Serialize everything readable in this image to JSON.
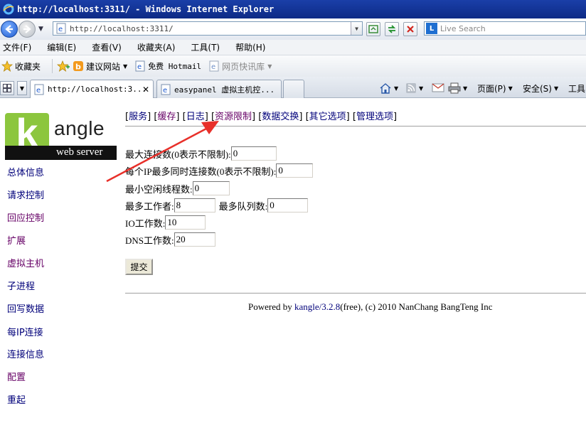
{
  "window": {
    "title": "http://localhost:3311/ - Windows Internet Explorer"
  },
  "address": {
    "url": "http://localhost:3311/"
  },
  "search": {
    "placeholder": "Live Search"
  },
  "menu": [
    "文件(F)",
    "编辑(E)",
    "查看(V)",
    "收藏夹(A)",
    "工具(T)",
    "帮助(H)"
  ],
  "favorites": {
    "label": "收藏夹",
    "items": [
      {
        "label": "建议网站",
        "dropdown": true
      },
      {
        "label": "免费 Hotmail"
      },
      {
        "label": "网页快讯库",
        "dropdown": true
      }
    ]
  },
  "tabs": [
    {
      "label": "http://localhost:3...",
      "active": true
    },
    {
      "label": "easypanel 虚拟主机控..."
    }
  ],
  "commands": {
    "page": "页面(P)",
    "safety": "安全(S)",
    "tools": "工具"
  },
  "logo": {
    "word": "angle",
    "letter": "k",
    "tagline": "web server"
  },
  "sidebar": [
    {
      "label": "总体信息",
      "color": "#00007a"
    },
    {
      "label": "请求控制",
      "color": "#00007a"
    },
    {
      "label": "回应控制",
      "color": "#660066"
    },
    {
      "label": "扩展",
      "color": "#660066"
    },
    {
      "label": "虚拟主机",
      "color": "#660066"
    },
    {
      "label": "子进程",
      "color": "#00007a"
    },
    {
      "label": "回写数据",
      "color": "#00007a"
    },
    {
      "label": "每IP连接",
      "color": "#00007a"
    },
    {
      "label": "连接信息",
      "color": "#00007a"
    },
    {
      "label": "配置",
      "color": "#660066"
    },
    {
      "label": "重起",
      "color": "#00007a"
    }
  ],
  "topnav": [
    {
      "label": "服务",
      "color": "#00007a"
    },
    {
      "label": "缓存",
      "color": "#660066"
    },
    {
      "label": "日志",
      "color": "#00007a"
    },
    {
      "label": "资源限制",
      "color": "#660066"
    },
    {
      "label": "数据交换",
      "color": "#00007a"
    },
    {
      "label": "其它选项",
      "color": "#00007a"
    },
    {
      "label": "管理选项",
      "color": "#00007a"
    }
  ],
  "form": {
    "max_conn": {
      "label": "最大连接数(0表示不限制):",
      "value": "0"
    },
    "per_ip": {
      "label": "每个IP最多同时连接数(0表示不限制):",
      "value": "0"
    },
    "min_idle": {
      "label": "最小空闲线程数:",
      "value": "0"
    },
    "max_worker": {
      "label": "最多工作者:",
      "value": "8"
    },
    "max_queue": {
      "label": "最多队列数:",
      "value": "0"
    },
    "io_worker": {
      "label": "IO工作数:",
      "value": "10"
    },
    "dns_worker": {
      "label": "DNS工作数:",
      "value": "20"
    },
    "submit": "提交"
  },
  "footer": {
    "prefix": "Powered by ",
    "link": "kangle/3.2.8",
    "suffix": "(free), (c) 2010 NanChang BangTeng Inc"
  },
  "colors": {
    "annotation_arrow": "#e8302a",
    "link": "#00007a",
    "visited": "#660066",
    "logo_green": "#8cc63e"
  }
}
